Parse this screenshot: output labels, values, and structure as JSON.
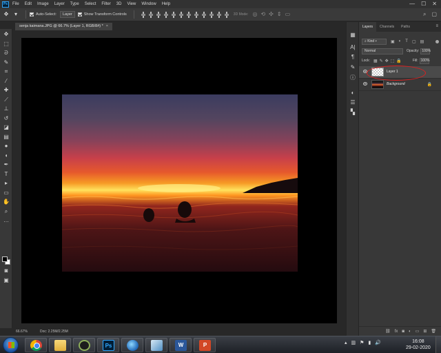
{
  "menubar": {
    "logo": "Ps",
    "items": [
      "File",
      "Edit",
      "Image",
      "Layer",
      "Type",
      "Select",
      "Filter",
      "3D",
      "View",
      "Window",
      "Help"
    ],
    "minimize": "—",
    "maximize": "☐",
    "close": "✕"
  },
  "options_bar": {
    "move_tool_icon": "move-icon",
    "auto_select_label": "Auto-Select:",
    "auto_select_value": "Layer",
    "transform_label": "Show Transform Controls",
    "mode_3d_label": "3D Mode:"
  },
  "document": {
    "tab_title": "senja kaimana.JPG @ 66.7% (Layer 1, RGB/8#) *",
    "tab_close": "×",
    "zoom": "66.67%",
    "doc_size": "Doc: 2.25M/2.25M"
  },
  "layers_panel": {
    "tabs": [
      "Layers",
      "Channels",
      "Paths"
    ],
    "kind_filter": "Kind",
    "blend_mode": "Normal",
    "opacity_label": "Opacity:",
    "opacity_value": "100%",
    "lock_label": "Lock:",
    "fill_label": "Fill:",
    "fill_value": "100%",
    "layers": [
      {
        "name": "Layer 1",
        "selected": true,
        "thumbnail": "transparent"
      },
      {
        "name": "Background",
        "selected": false,
        "thumbnail": "photo",
        "locked": true
      }
    ],
    "highlight_color": "#e02020"
  },
  "taskbar": {
    "time": "16:08",
    "date": "29-02-2020",
    "ps_label": "Ps",
    "word_label": "W",
    "ppt_label": "P"
  }
}
